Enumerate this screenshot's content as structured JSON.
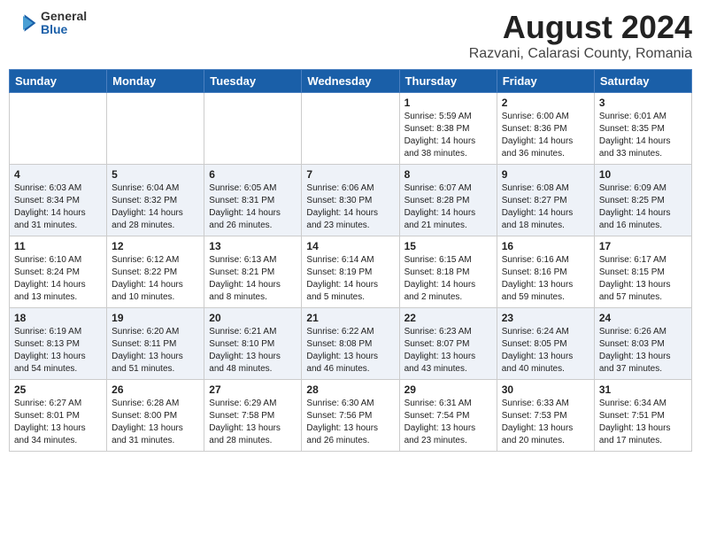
{
  "logo": {
    "general": "General",
    "blue": "Blue"
  },
  "header": {
    "title": "August 2024",
    "subtitle": "Razvani, Calarasi County, Romania"
  },
  "weekdays": [
    "Sunday",
    "Monday",
    "Tuesday",
    "Wednesday",
    "Thursday",
    "Friday",
    "Saturday"
  ],
  "weeks": [
    [
      {
        "day": "",
        "info": ""
      },
      {
        "day": "",
        "info": ""
      },
      {
        "day": "",
        "info": ""
      },
      {
        "day": "",
        "info": ""
      },
      {
        "day": "1",
        "info": "Sunrise: 5:59 AM\nSunset: 8:38 PM\nDaylight: 14 hours\nand 38 minutes."
      },
      {
        "day": "2",
        "info": "Sunrise: 6:00 AM\nSunset: 8:36 PM\nDaylight: 14 hours\nand 36 minutes."
      },
      {
        "day": "3",
        "info": "Sunrise: 6:01 AM\nSunset: 8:35 PM\nDaylight: 14 hours\nand 33 minutes."
      }
    ],
    [
      {
        "day": "4",
        "info": "Sunrise: 6:03 AM\nSunset: 8:34 PM\nDaylight: 14 hours\nand 31 minutes."
      },
      {
        "day": "5",
        "info": "Sunrise: 6:04 AM\nSunset: 8:32 PM\nDaylight: 14 hours\nand 28 minutes."
      },
      {
        "day": "6",
        "info": "Sunrise: 6:05 AM\nSunset: 8:31 PM\nDaylight: 14 hours\nand 26 minutes."
      },
      {
        "day": "7",
        "info": "Sunrise: 6:06 AM\nSunset: 8:30 PM\nDaylight: 14 hours\nand 23 minutes."
      },
      {
        "day": "8",
        "info": "Sunrise: 6:07 AM\nSunset: 8:28 PM\nDaylight: 14 hours\nand 21 minutes."
      },
      {
        "day": "9",
        "info": "Sunrise: 6:08 AM\nSunset: 8:27 PM\nDaylight: 14 hours\nand 18 minutes."
      },
      {
        "day": "10",
        "info": "Sunrise: 6:09 AM\nSunset: 8:25 PM\nDaylight: 14 hours\nand 16 minutes."
      }
    ],
    [
      {
        "day": "11",
        "info": "Sunrise: 6:10 AM\nSunset: 8:24 PM\nDaylight: 14 hours\nand 13 minutes."
      },
      {
        "day": "12",
        "info": "Sunrise: 6:12 AM\nSunset: 8:22 PM\nDaylight: 14 hours\nand 10 minutes."
      },
      {
        "day": "13",
        "info": "Sunrise: 6:13 AM\nSunset: 8:21 PM\nDaylight: 14 hours\nand 8 minutes."
      },
      {
        "day": "14",
        "info": "Sunrise: 6:14 AM\nSunset: 8:19 PM\nDaylight: 14 hours\nand 5 minutes."
      },
      {
        "day": "15",
        "info": "Sunrise: 6:15 AM\nSunset: 8:18 PM\nDaylight: 14 hours\nand 2 minutes."
      },
      {
        "day": "16",
        "info": "Sunrise: 6:16 AM\nSunset: 8:16 PM\nDaylight: 13 hours\nand 59 minutes."
      },
      {
        "day": "17",
        "info": "Sunrise: 6:17 AM\nSunset: 8:15 PM\nDaylight: 13 hours\nand 57 minutes."
      }
    ],
    [
      {
        "day": "18",
        "info": "Sunrise: 6:19 AM\nSunset: 8:13 PM\nDaylight: 13 hours\nand 54 minutes."
      },
      {
        "day": "19",
        "info": "Sunrise: 6:20 AM\nSunset: 8:11 PM\nDaylight: 13 hours\nand 51 minutes."
      },
      {
        "day": "20",
        "info": "Sunrise: 6:21 AM\nSunset: 8:10 PM\nDaylight: 13 hours\nand 48 minutes."
      },
      {
        "day": "21",
        "info": "Sunrise: 6:22 AM\nSunset: 8:08 PM\nDaylight: 13 hours\nand 46 minutes."
      },
      {
        "day": "22",
        "info": "Sunrise: 6:23 AM\nSunset: 8:07 PM\nDaylight: 13 hours\nand 43 minutes."
      },
      {
        "day": "23",
        "info": "Sunrise: 6:24 AM\nSunset: 8:05 PM\nDaylight: 13 hours\nand 40 minutes."
      },
      {
        "day": "24",
        "info": "Sunrise: 6:26 AM\nSunset: 8:03 PM\nDaylight: 13 hours\nand 37 minutes."
      }
    ],
    [
      {
        "day": "25",
        "info": "Sunrise: 6:27 AM\nSunset: 8:01 PM\nDaylight: 13 hours\nand 34 minutes."
      },
      {
        "day": "26",
        "info": "Sunrise: 6:28 AM\nSunset: 8:00 PM\nDaylight: 13 hours\nand 31 minutes."
      },
      {
        "day": "27",
        "info": "Sunrise: 6:29 AM\nSunset: 7:58 PM\nDaylight: 13 hours\nand 28 minutes."
      },
      {
        "day": "28",
        "info": "Sunrise: 6:30 AM\nSunset: 7:56 PM\nDaylight: 13 hours\nand 26 minutes."
      },
      {
        "day": "29",
        "info": "Sunrise: 6:31 AM\nSunset: 7:54 PM\nDaylight: 13 hours\nand 23 minutes."
      },
      {
        "day": "30",
        "info": "Sunrise: 6:33 AM\nSunset: 7:53 PM\nDaylight: 13 hours\nand 20 minutes."
      },
      {
        "day": "31",
        "info": "Sunrise: 6:34 AM\nSunset: 7:51 PM\nDaylight: 13 hours\nand 17 minutes."
      }
    ]
  ]
}
